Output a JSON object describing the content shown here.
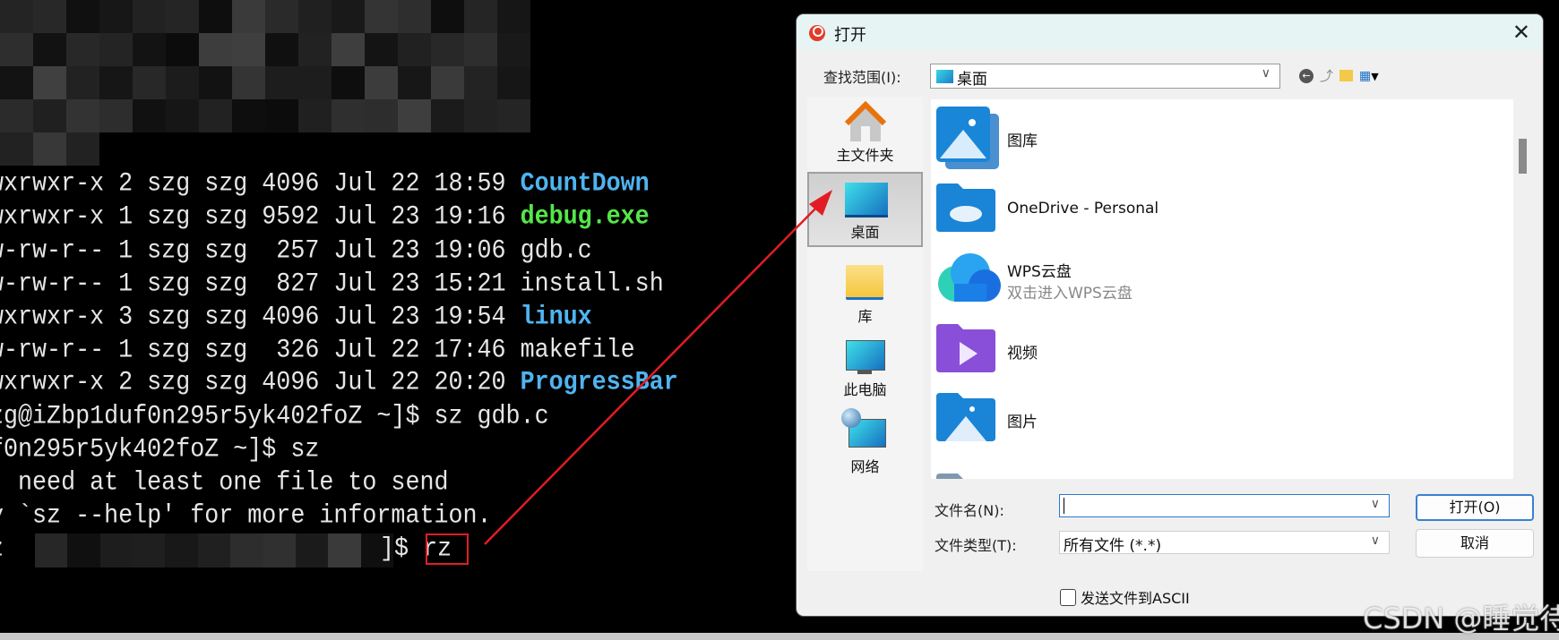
{
  "terminal": {
    "listing": [
      {
        "prefix": "wxrwxr-x 2 szg szg 4096 Jul 22 18:59 ",
        "name": "CountDown",
        "kind": "dir"
      },
      {
        "prefix": "wxrwxr-x 1 szg szg 9592 Jul 23 19:16 ",
        "name": "debug.exe",
        "kind": "exec"
      },
      {
        "prefix": "w-rw-r-- 1 szg szg  257 Jul 23 19:06 ",
        "name": "gdb.c",
        "kind": "file"
      },
      {
        "prefix": "w-rw-r-- 1 szg szg  827 Jul 23 15:21 ",
        "name": "install.sh",
        "kind": "file"
      },
      {
        "prefix": "wxrwxr-x 3 szg szg 4096 Jul 23 19:54 ",
        "name": "linux",
        "kind": "dir"
      },
      {
        "prefix": "w-rw-r-- 1 szg szg  326 Jul 22 17:46 ",
        "name": "makefile",
        "kind": "file"
      },
      {
        "prefix": "wxrwxr-x 2 szg szg 4096 Jul 22 20:20 ",
        "name": "ProgressBar",
        "kind": "dir"
      }
    ],
    "lines": [
      "zg@iZbp1duf0n295r5yk402foZ ~]$ sz gdb.c",
      "f0n295r5yk402foZ ~]$ sz",
      "  need at least one file to send",
      "y `sz --help' for more information."
    ],
    "last_prompt_tail": "]$ ",
    "last_command": "rz",
    "colors": {
      "dir": "#4fb4f0",
      "exec": "#55e64a",
      "highlight_box": "#e21c24"
    }
  },
  "dialog": {
    "title": "打开",
    "close_icon": "close-icon",
    "look_in_label": "查找范围(I):",
    "look_in_value": "桌面",
    "toolbar_icons": [
      "back-icon",
      "up-folder-icon",
      "new-folder-icon",
      "view-menu-icon"
    ],
    "places": [
      {
        "label": "主文件夹",
        "icon": "home-icon"
      },
      {
        "label": "桌面",
        "icon": "desktop-icon",
        "selected": true
      },
      {
        "label": "库",
        "icon": "library-folder-icon"
      },
      {
        "label": "此电脑",
        "icon": "computer-icon"
      },
      {
        "label": "网络",
        "icon": "network-icon"
      }
    ],
    "files": [
      {
        "name": "图库",
        "icon": "gallery-icon"
      },
      {
        "name": "OneDrive - Personal",
        "icon": "onedrive-folder-icon"
      },
      {
        "name": "WPS云盘",
        "subtitle": "双击进入WPS云盘",
        "icon": "wps-cloud-icon"
      },
      {
        "name": "视频",
        "icon": "videos-folder-icon"
      },
      {
        "name": "图片",
        "icon": "pictures-folder-icon"
      }
    ],
    "filename_label": "文件名(N):",
    "filename_value": "",
    "filetype_label": "文件类型(T):",
    "filetype_value": "所有文件 (*.*)",
    "open_button": "打开(O)",
    "cancel_button": "取消",
    "ascii_checkbox_label": "发送文件到ASCII",
    "ascii_checked": false
  },
  "watermark": "CSDN @睡觉待开机"
}
